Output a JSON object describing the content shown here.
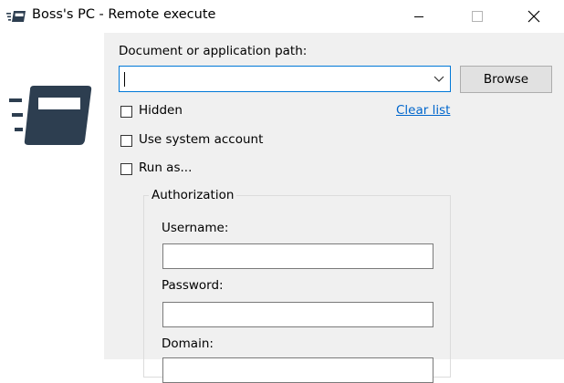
{
  "window": {
    "title": "Boss's PC - Remote execute",
    "controls": [
      "minimize",
      "maximize",
      "close"
    ],
    "app_icon": "remote-execute-icon"
  },
  "form": {
    "path_label": "Document or application path:",
    "path_value": "",
    "browse_label": "Browse",
    "clear_list_label": "Clear list",
    "options": [
      {
        "label": "Hidden",
        "checked": false
      },
      {
        "label": "Use system account",
        "checked": false
      },
      {
        "label": "Run as...",
        "checked": false
      }
    ]
  },
  "authorization": {
    "title": "Authorization",
    "username_label": "Username:",
    "username_value": "",
    "password_label": "Password:",
    "password_value": "",
    "domain_label": "Domain:",
    "domain_value": ""
  },
  "colors": {
    "accent": "#0078d7",
    "link": "#0066cc",
    "icon": "#2d3e50",
    "client_bg": "#f0f0f0"
  }
}
